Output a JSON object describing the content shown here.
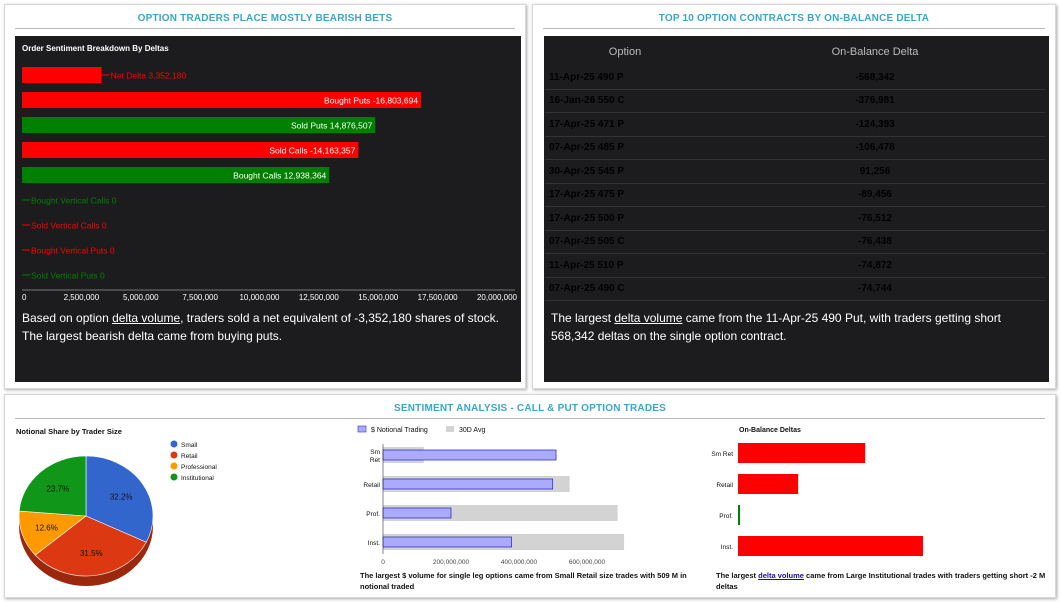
{
  "panels": {
    "left_title": "OPTION TRADERS PLACE MOSTLY BEARISH BETS",
    "right_title": "TOP 10 OPTION CONTRACTS BY ON-BALANCE DELTA",
    "bottom_title": "SENTIMENT ANALYSIS - CALL & PUT OPTION TRADES"
  },
  "left_note": {
    "part1": "Based on option ",
    "link": "delta volume",
    "part2": ", traders sold a net equivalent of -3,352,180 shares of stock. The largest bearish delta came from buying puts."
  },
  "right_note": {
    "part1": "The largest ",
    "link": "delta volume",
    "part2": " came from the 11-Apr-25 490 Put, with traders getting short 568,342 deltas on the single option contract."
  },
  "table": {
    "headers": [
      "Option",
      "On-Balance Delta"
    ],
    "rows": [
      [
        "11-Apr-25 490 P",
        "-568,342"
      ],
      [
        "16-Jan-26 550 C",
        "-376,981"
      ],
      [
        "17-Apr-25 471 P",
        "-124,393"
      ],
      [
        "07-Apr-25 485 P",
        "-106,478"
      ],
      [
        "30-Apr-25 545 P",
        "91,256"
      ],
      [
        "17-Apr-25 475 P",
        "-89,456"
      ],
      [
        "17-Apr-25 500 P",
        "-76,512"
      ],
      [
        "07-Apr-25 505 C",
        "-76,438"
      ],
      [
        "11-Apr-25 510 P",
        "-74,872"
      ],
      [
        "07-Apr-25 490 C",
        "-74,744"
      ]
    ]
  },
  "bottom_notes": {
    "bar_note": "The largest $ volume for single leg options came from Small Retail size trades with 509 M in notional traded",
    "obd_part1": "The largest ",
    "obd_link": "delta volume",
    "obd_part2": " came from Large Institutional trades with traders getting short -2 M deltas"
  },
  "colors": {
    "red": "#ff0000",
    "green": "#008000",
    "bar_blue": "#aaaaff",
    "bar_grey": "#d3d3d3",
    "dark_bg": "#1c1c1f"
  },
  "chart_data": [
    {
      "type": "bar",
      "orientation": "horizontal",
      "title": "Order Sentiment Breakdown By Deltas",
      "categories": [
        "Net Delta",
        "Bought Puts",
        "Sold Puts",
        "Sold Calls",
        "Bought Calls",
        "Bought Vertical Calls",
        "Sold Vertical Calls",
        "Bought Vertical Puts",
        "Sold Vertical Puts"
      ],
      "values": [
        3352180,
        16803694,
        14876507,
        14163357,
        12938364,
        0,
        0,
        0,
        0
      ],
      "labels": [
        "Net Delta 3,352,180",
        "Bought Puts -16,803,694",
        "Sold Puts 14,876,507",
        "Sold Calls -14,163,357",
        "Bought Calls 12,938,364",
        "Bought Vertical Calls 0",
        "Sold Vertical Calls 0",
        "Bought Vertical Puts 0",
        "Sold Vertical Puts 0"
      ],
      "colors": [
        "red",
        "red",
        "green",
        "red",
        "green",
        "green",
        "red",
        "red",
        "green"
      ],
      "label_inside": [
        false,
        true,
        true,
        true,
        true,
        false,
        false,
        false,
        false
      ],
      "xlim": [
        0,
        20000000
      ],
      "xticks": [
        "0",
        "2,500,000",
        "5,000,000",
        "7,500,000",
        "10,000,000",
        "12,500,000",
        "15,000,000",
        "17,500,000",
        "20,000,000"
      ]
    },
    {
      "type": "pie",
      "title": "Notional Share by Trader Size",
      "series": [
        {
          "name": "Small",
          "value": 32.2,
          "color": "#3366cc",
          "label": "32.2%"
        },
        {
          "name": "Retail",
          "value": 31.5,
          "color": "#dc3912",
          "label": "31.5%"
        },
        {
          "name": "Professional",
          "value": 12.6,
          "color": "#ff9900",
          "label": "12.6%"
        },
        {
          "name": "Institutional",
          "value": 23.7,
          "color": "#109618",
          "label": "23.7%"
        }
      ],
      "legend": "right"
    },
    {
      "type": "bar",
      "orientation": "horizontal",
      "categories": [
        "Sm Ret",
        "Retail",
        "Prof.",
        "Inst."
      ],
      "series": [
        {
          "name": "$ Notional Trading",
          "values": [
            509000000,
            499000000,
            200000000,
            378000000
          ]
        },
        {
          "name": "30D Avg",
          "values": [
            120000000,
            549000000,
            690000000,
            709000000
          ]
        }
      ],
      "xlim": [
        0,
        700000000
      ],
      "xticks": [
        "0",
        "200,000,000",
        "400,000,000",
        "600,000,000"
      ],
      "legend": "top"
    },
    {
      "type": "bar",
      "orientation": "horizontal",
      "title": "On-Balance Deltas",
      "categories": [
        "Sm Ret",
        "Retail",
        "Prof.",
        "Inst."
      ],
      "values": [
        -1100000,
        -520000,
        15000,
        -1600000
      ],
      "colors": [
        "red",
        "red",
        "green",
        "red"
      ]
    }
  ]
}
